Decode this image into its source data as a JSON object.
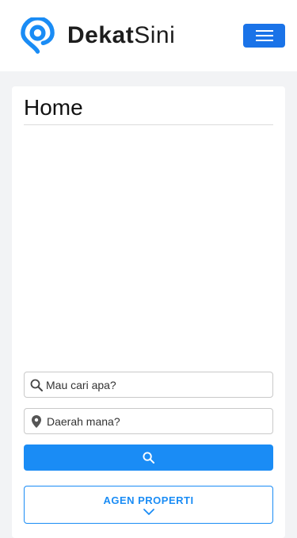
{
  "navbar": {
    "logo_bold": "Dekat",
    "logo_light": "Sini",
    "menu_icon": "hamburger-icon",
    "brand_color": "#1a73e8"
  },
  "main": {
    "title": "Home",
    "search": {
      "keyword_placeholder": "Mau cari apa?",
      "keyword_icon": "search-icon",
      "location_placeholder": "Daerah mana?",
      "location_icon": "map-marker-icon",
      "button_icon": "search-icon"
    },
    "agent_button": {
      "label": "AGEN PROPERTI",
      "icon": "chevron-down-icon"
    },
    "accent_color": "#1a8cf5"
  }
}
